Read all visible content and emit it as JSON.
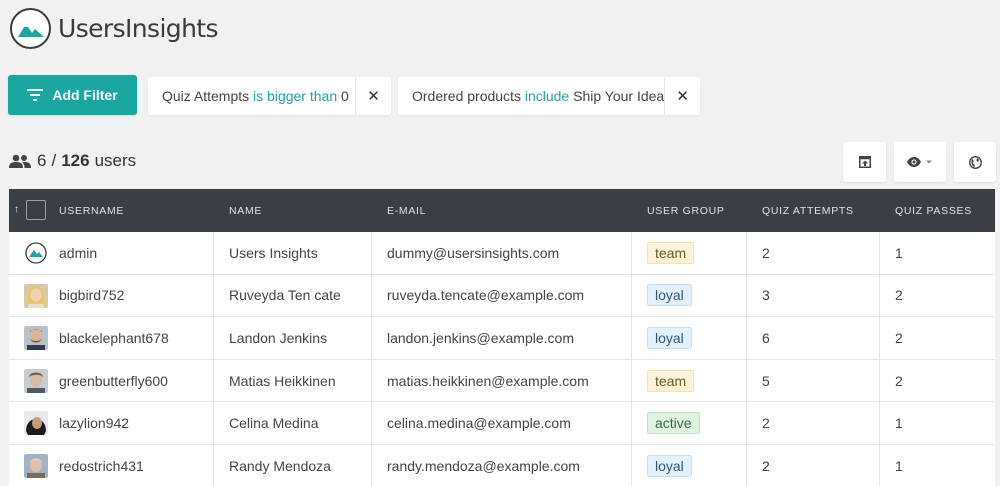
{
  "app": {
    "logo_text": "UsersInsights"
  },
  "toolbar": {
    "add_filter_label": "Add Filter",
    "filters": [
      {
        "field": "Quiz Attempts",
        "operator": "is bigger than",
        "value": "0"
      },
      {
        "field": "Ordered products",
        "operator": "include",
        "value": "Ship Your Idea"
      }
    ]
  },
  "summary": {
    "shown": "6",
    "separator": "/",
    "total": "126",
    "unit": "users"
  },
  "table": {
    "columns": [
      "USERNAME",
      "NAME",
      "E-MAIL",
      "USER GROUP",
      "QUIZ ATTEMPTS",
      "QUIZ PASSES"
    ],
    "sort_indicator": "↑",
    "rows": [
      {
        "username": "admin",
        "name": "Users Insights",
        "email": "dummy@usersinsights.com",
        "group": "team",
        "attempts": "2",
        "passes": "1"
      },
      {
        "username": "bigbird752",
        "name": "Ruveyda Ten cate",
        "email": "ruveyda.tencate@example.com",
        "group": "loyal",
        "attempts": "3",
        "passes": "2"
      },
      {
        "username": "blackelephant678",
        "name": "Landon Jenkins",
        "email": "landon.jenkins@example.com",
        "group": "loyal",
        "attempts": "6",
        "passes": "2"
      },
      {
        "username": "greenbutterfly600",
        "name": "Matias Heikkinen",
        "email": "matias.heikkinen@example.com",
        "group": "team",
        "attempts": "5",
        "passes": "2"
      },
      {
        "username": "lazylion942",
        "name": "Celina Medina",
        "email": "celina.medina@example.com",
        "group": "active",
        "attempts": "2",
        "passes": "1"
      },
      {
        "username": "redostrich431",
        "name": "Randy Mendoza",
        "email": "randy.mendoza@example.com",
        "group": "loyal",
        "attempts": "2",
        "passes": "1"
      }
    ]
  },
  "colors": {
    "accent": "#1aa7a1",
    "header_bg": "#3b3f45",
    "page_bg": "#f1f1f1"
  },
  "icons": {
    "filter": "filter-lines-icon",
    "users": "users-group-icon",
    "export": "export-icon",
    "visibility": "eye-icon",
    "globe": "globe-icon"
  }
}
